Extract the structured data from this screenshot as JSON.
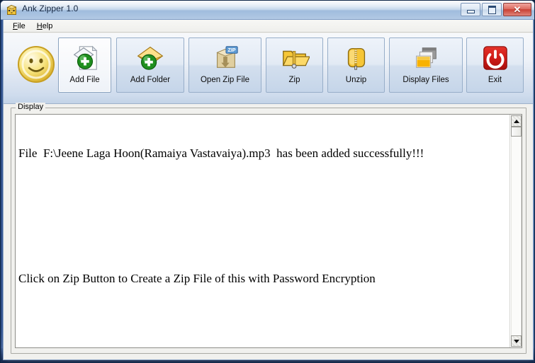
{
  "window": {
    "title": "Ank Zipper 1.0",
    "icon": "zip-bag-icon",
    "controls": {
      "minimize": "—",
      "maximize": "❐",
      "close": "✕"
    }
  },
  "menubar": {
    "items": [
      {
        "label": "File",
        "mnemonic": "F"
      },
      {
        "label": "Help",
        "mnemonic": "H"
      }
    ]
  },
  "toolbar": {
    "logo": "smiley-face-logo",
    "buttons": [
      {
        "id": "add-file",
        "label": "Add File",
        "icon": "document-add-icon",
        "state": "hovered"
      },
      {
        "id": "add-folder",
        "label": "Add Folder",
        "icon": "folder-add-icon",
        "state": "normal"
      },
      {
        "id": "open-zip-file",
        "label": "Open Zip File",
        "icon": "zip-package-open-icon",
        "state": "normal"
      },
      {
        "id": "zip",
        "label": "Zip",
        "icon": "folder-zipper-icon",
        "state": "normal"
      },
      {
        "id": "unzip",
        "label": "Unzip",
        "icon": "zipped-bag-icon",
        "state": "normal"
      },
      {
        "id": "display-files",
        "label": "Display Files",
        "icon": "stacked-windows-icon",
        "state": "normal"
      },
      {
        "id": "exit",
        "label": "Exit",
        "icon": "power-button-icon",
        "state": "normal"
      }
    ]
  },
  "display_group": {
    "legend": "Display",
    "lines": [
      "File  F:\\Jeene Laga Hoon(Ramaiya Vastavaiya).mp3  has been added successfully!!!",
      "",
      "",
      "Click on Zip Button to Create a Zip File of this with Password Encryption"
    ]
  },
  "scrollbar": {
    "up_arrow": "scroll-up-icon",
    "down_arrow": "scroll-down-icon"
  },
  "colors": {
    "title_bar_top": "#e9f0f8",
    "frame_blue": "#24427a",
    "close_red": "#c94134",
    "exit_red": "#cf1b17",
    "accent_green": "#29a329",
    "folder_yellow": "#f5c233"
  }
}
